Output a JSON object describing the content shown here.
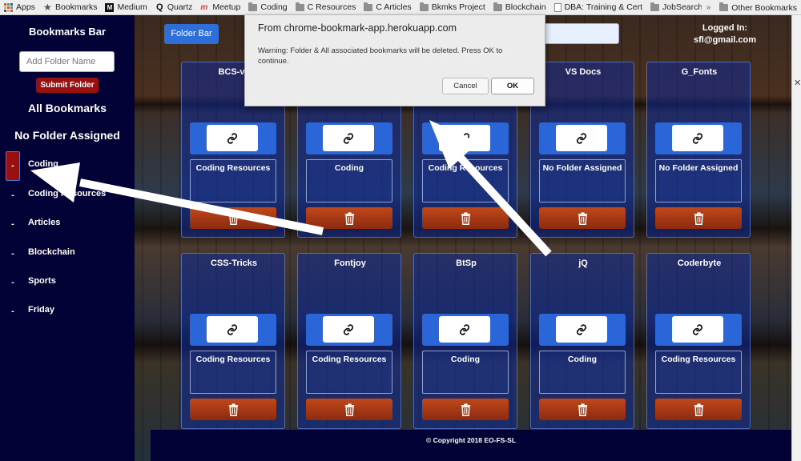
{
  "bookmarks_bar": {
    "items": [
      {
        "label": "Apps",
        "icon": "apps-grid-icon"
      },
      {
        "label": "Bookmarks",
        "icon": "star-icon"
      },
      {
        "label": "Medium",
        "icon": "medium-icon"
      },
      {
        "label": "Quartz",
        "icon": "quartz-icon"
      },
      {
        "label": "Meetup",
        "icon": "meetup-icon"
      },
      {
        "label": "Coding",
        "icon": "folder-icon"
      },
      {
        "label": "C Resources",
        "icon": "folder-icon"
      },
      {
        "label": "C Articles",
        "icon": "folder-icon"
      },
      {
        "label": "Bkmks Project",
        "icon": "folder-icon"
      },
      {
        "label": "Blockchain",
        "icon": "folder-icon"
      },
      {
        "label": "DBA: Training & Cert",
        "icon": "page-icon"
      },
      {
        "label": "JobSearch",
        "icon": "folder-icon"
      }
    ],
    "overflow": "»",
    "other": "Other Bookmarks"
  },
  "sidebar": {
    "title": "Bookmarks Bar",
    "input_placeholder": "Add Folder Name",
    "submit_label": "Submit Folder",
    "all_label": "All Bookmarks",
    "no_folder_label": "No Folder Assigned",
    "folders": [
      {
        "minus": "-",
        "label": "Coding",
        "active": true
      },
      {
        "minus": "-",
        "label": "Coding Resources",
        "active": false
      },
      {
        "minus": "-",
        "label": "Articles",
        "active": false
      },
      {
        "minus": "-",
        "label": "Blockchain",
        "active": false
      },
      {
        "minus": "-",
        "label": "Sports",
        "active": false
      },
      {
        "minus": "-",
        "label": "Friday",
        "active": false
      }
    ]
  },
  "header": {
    "folder_bar_label": "Folder Bar",
    "logged_in_label": "Logged In:",
    "user_email": "sfl@gmail.com"
  },
  "cards": [
    {
      "title": "BCS-v2",
      "category": "Coding Resources"
    },
    {
      "title": "",
      "category": "Coding"
    },
    {
      "title": "",
      "category": "Coding Resources"
    },
    {
      "title": "VS Docs",
      "category": "No Folder Assigned"
    },
    {
      "title": "G_Fonts",
      "category": "No Folder Assigned"
    },
    {
      "title": "CSS-Tricks",
      "category": "Coding Resources"
    },
    {
      "title": "Fontjoy",
      "category": "Coding Resources"
    },
    {
      "title": "BtSp",
      "category": "Coding"
    },
    {
      "title": "jQ",
      "category": "Coding"
    },
    {
      "title": "Coderbyte",
      "category": "Coding Resources"
    }
  ],
  "footer": {
    "text": "© Copyright 2018 EO-FS-SL"
  },
  "dialog": {
    "title": "From chrome-bookmark-app.herokuapp.com",
    "message": "Warning: Folder & All associated bookmarks will be deleted. Press OK to continue.",
    "cancel_label": "Cancel",
    "ok_label": "OK"
  },
  "colors": {
    "sidebar_bg": "#020236",
    "accent_blue": "#2d6ed8",
    "danger_red": "#9a1010",
    "delete_orange": "#c0481a"
  }
}
